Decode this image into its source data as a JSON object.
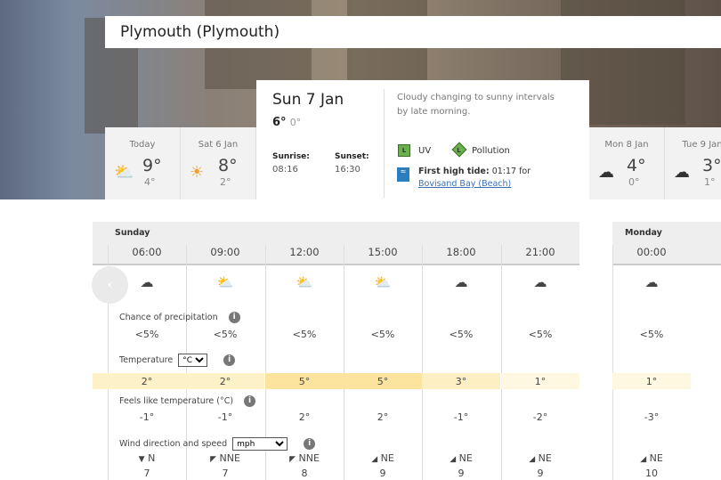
{
  "location": "Plymouth (Plymouth)",
  "day_cards": [
    {
      "label": "Today",
      "icon": "sun-cloud-icon",
      "high": "9°",
      "low": "4°"
    },
    {
      "label": "Sat 6 Jan",
      "icon": "sun-icon",
      "high": "8°",
      "low": "2°"
    },
    {
      "label": "Mon 8 Jan",
      "icon": "cloud-icon",
      "high": "4°",
      "low": "0°"
    },
    {
      "label": "Tue 9 Jan",
      "icon": "cloud-icon",
      "high": "3°",
      "low": "1°"
    }
  ],
  "selected_day": {
    "date": "Sun 7 Jan",
    "high": "6°",
    "low": "0°",
    "description": "Cloudy changing to sunny intervals by late morning.",
    "sunrise_label": "Sunrise:",
    "sunrise": "08:16",
    "sunset_label": "Sunset:",
    "sunset": "16:30",
    "uv_level": "L",
    "uv_label": "UV",
    "pollution_level": "L",
    "pollution_label": "Pollution",
    "tide_label": "First high tide:",
    "tide_text": " 01:17 for",
    "tide_location": "Bovisand Bay (Beach)",
    "badge_color": "#6ab04c"
  },
  "hourly": {
    "day1": "Sunday",
    "day2": "Monday",
    "precip_label": "Chance of precipitation",
    "temp_label": "Temperature",
    "temp_unit": "°C",
    "feels_label": "Feels like temperature (°C)",
    "wind_label": "Wind direction and speed",
    "wind_unit": "mph",
    "columns": [
      {
        "time": "06:00",
        "icon": "cloud-icon",
        "precip": "<5%",
        "temp": "2°",
        "temp_color": "#fdf1c8",
        "feels": "-1°",
        "dir": "N",
        "arrow": "▼",
        "speed": "7"
      },
      {
        "time": "09:00",
        "icon": "sun-cloud-icon",
        "precip": "<5%",
        "temp": "2°",
        "temp_color": "#fdf1c8",
        "feels": "-1°",
        "dir": "NNE",
        "arrow": "◤",
        "speed": "7"
      },
      {
        "time": "12:00",
        "icon": "sun-cloud-icon",
        "precip": "<5%",
        "temp": "5°",
        "temp_color": "#fde49e",
        "feels": "2°",
        "dir": "NNE",
        "arrow": "◤",
        "speed": "8"
      },
      {
        "time": "15:00",
        "icon": "sun-cloud-icon",
        "precip": "<5%",
        "temp": "5°",
        "temp_color": "#fde49e",
        "feels": "2°",
        "dir": "NE",
        "arrow": "◢",
        "speed": "9"
      },
      {
        "time": "18:00",
        "icon": "cloud-icon",
        "precip": "<5%",
        "temp": "3°",
        "temp_color": "#fdefc2",
        "feels": "-1°",
        "dir": "NE",
        "arrow": "◢",
        "speed": "9"
      },
      {
        "time": "21:00",
        "icon": "moon-cloud-icon",
        "precip": "<5%",
        "temp": "1°",
        "temp_color": "#fef8e0",
        "feels": "-2°",
        "dir": "NE",
        "arrow": "◢",
        "speed": "9"
      },
      {
        "time": "00:00",
        "icon": "moon-cloud-icon",
        "precip": "<5%",
        "temp": "1°",
        "temp_color": "#fef8e0",
        "feels": "-3°",
        "dir": "NE",
        "arrow": "◢",
        "speed": "10"
      }
    ]
  }
}
